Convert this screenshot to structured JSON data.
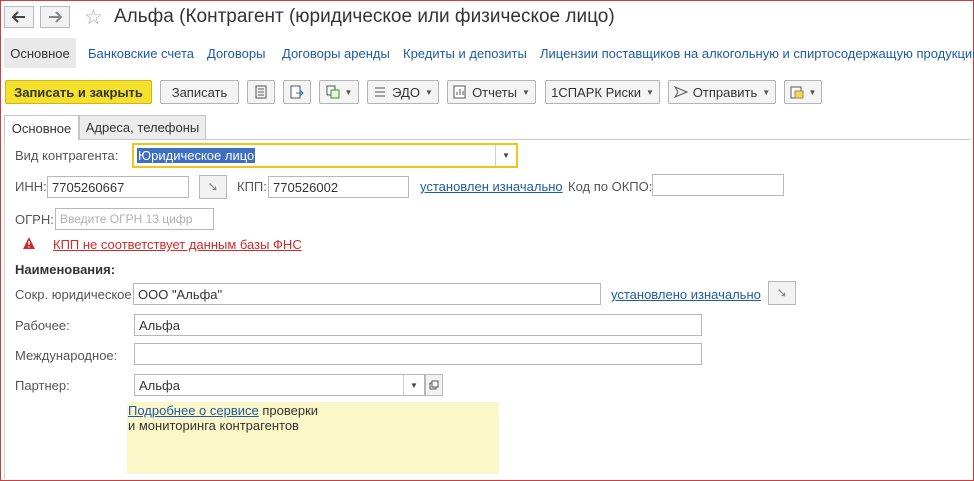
{
  "window": {
    "title": "Альфа (Контрагент (юридическое или физическое лицо)",
    "back_icon": "arrow-left-icon",
    "forward_icon": "arrow-right-icon",
    "favorite_icon": "star-icon"
  },
  "top_nav": {
    "items": [
      {
        "label": "Основное"
      },
      {
        "label": "Банковские счета"
      },
      {
        "label": "Договоры"
      },
      {
        "label": "Договоры аренды"
      },
      {
        "label": "Кредиты и депозиты"
      },
      {
        "label": "Лицензии поставщиков на алкогольную и спиртосодержащую продукцию"
      }
    ]
  },
  "toolbar": {
    "save_close": "Записать и закрыть",
    "save": "Записать",
    "edo": "ЭДО",
    "reports": "Отчеты",
    "spark": "1СПАРК Риски",
    "send": "Отправить"
  },
  "tabs": [
    {
      "label": "Основное"
    },
    {
      "label": "Адреса, телефоны"
    }
  ],
  "form": {
    "kind_label": "Вид контрагента:",
    "kind_value": "Юридическое лицо",
    "inn_label": "ИНН:",
    "inn_value": "7705260667",
    "kpp_label": "КПП:",
    "kpp_value": "770526002",
    "kpp_status": "установлен изначально",
    "okpo_label": "Код по ОКПО:",
    "okpo_value": "",
    "ogrn_label": "ОГРН:",
    "ogrn_placeholder": "Введите ОГРН 13 цифр",
    "warning": "КПП не соответствует данным базы ФНС",
    "names_header": "Наименования:",
    "short_label": "Сокр. юридическое:",
    "short_value": "ООО \"Альфа\"",
    "short_status": "установлено изначально",
    "working_label": "Рабочее:",
    "working_value": "Альфа",
    "intl_label": "Международное:",
    "intl_value": "",
    "partner_label": "Партнер:",
    "partner_value": "Альфа"
  },
  "note": {
    "link": "Подробнее о сервисе",
    "text1": " проверки",
    "text2": "и мониторинга контрагентов"
  },
  "colors": {
    "primary_button": "#f5e12b",
    "link": "#1c5ba8",
    "error": "#d12b2b",
    "focus_border": "#f0c419",
    "note_bg": "#fcf7c9",
    "frame": "#d63a3a"
  }
}
